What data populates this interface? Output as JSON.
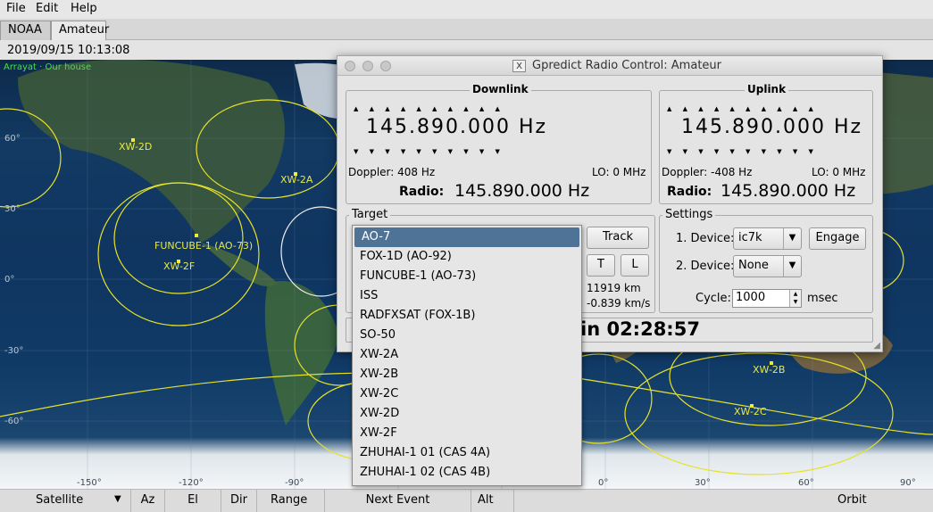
{
  "menu": {
    "file": "File",
    "file_key": "F",
    "edit": "Edit",
    "edit_key": "E",
    "help": "Help",
    "help_key": "H"
  },
  "tabs": [
    "NOAA",
    "Amateur"
  ],
  "datetime": "2019/09/15 10:13:08",
  "map": {
    "location_label": "Arrayat · Our house",
    "satellite_labels": [
      "XW-2D",
      "XW-2A",
      "FUNCUBE-1 (AO-73)",
      "XW-2F",
      "XW-2B",
      "XW-2C"
    ],
    "lat_labels": [
      "60°",
      "30°",
      "0°",
      "-30°",
      "-60°"
    ],
    "lon_labels": [
      "-150°",
      "-120°",
      "-90°",
      "0°",
      "30°",
      "60°",
      "90°"
    ]
  },
  "bottom_columns": [
    "Satellite",
    "Az",
    "El",
    "Dir",
    "Range",
    "Next Event",
    "Alt",
    "Orbit"
  ],
  "rig": {
    "title": "Gpredict Radio Control: Amateur",
    "downlink": {
      "title": "Downlink",
      "ticks": "▲ ▲ ▲ ▲ ▲ ▲ ▲ ▲ ▲ ▲",
      "ticks_down": "▼ ▼ ▼ ▼ ▼ ▼ ▼ ▼ ▼ ▼",
      "freq": "145.890.000 Hz",
      "doppler": "Doppler: 408 Hz",
      "lo": "LO: 0 MHz",
      "radio_label": "Radio:",
      "radio_freq": "145.890.000 Hz"
    },
    "uplink": {
      "title": "Uplink",
      "freq": "145.890.000 Hz",
      "doppler": "Doppler: -408 Hz",
      "lo": "LO: 0 MHz",
      "radio_label": "Radio:",
      "radio_freq": "145.890.000 Hz"
    },
    "target": {
      "title": "Target",
      "track_btn": "Track",
      "t_btn": "T",
      "l_btn": "L",
      "range": "11919 km",
      "rate": "-0.839 km/s",
      "countdown": "in 02:28:57"
    },
    "settings": {
      "title": "Settings",
      "device1_label": "1. Device:",
      "device1_value": "ic7k",
      "engage_btn": "Engage",
      "device2_label": "2. Device:",
      "device2_value": "None",
      "cycle_label": "Cycle:",
      "cycle_value": "1000",
      "cycle_unit": "msec"
    }
  },
  "dropdown": {
    "selected_index": 0,
    "items": [
      "AO-7",
      "FOX-1D (AO-92)",
      "FUNCUBE-1 (AO-73)",
      "ISS",
      "RADFXSAT (FOX-1B)",
      "SO-50",
      "XW-2A",
      "XW-2B",
      "XW-2C",
      "XW-2D",
      "XW-2F",
      "ZHUHAI-1 01 (CAS 4A)",
      "ZHUHAI-1 02 (CAS 4B)"
    ]
  }
}
